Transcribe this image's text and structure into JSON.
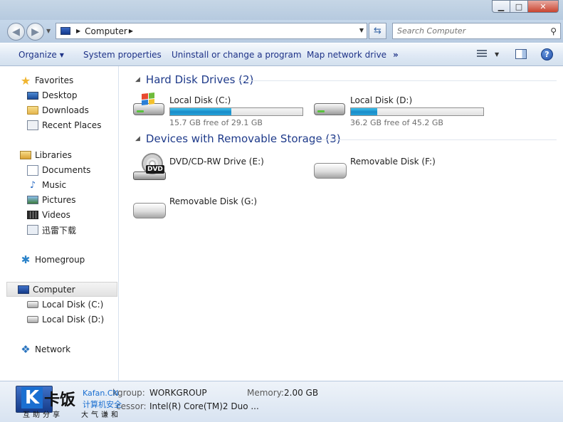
{
  "window": {
    "minimize_glyph": "▁",
    "maximize_glyph": "□",
    "close_glyph": "✕"
  },
  "address": {
    "path": "Computer",
    "search_placeholder": "Search Computer"
  },
  "toolbar": {
    "organize": "Organize",
    "system_properties": "System properties",
    "uninstall": "Uninstall or change a program",
    "map_drive": "Map network drive",
    "more": "»",
    "help": "?"
  },
  "nav": {
    "favorites": "Favorites",
    "desktop": "Desktop",
    "downloads": "Downloads",
    "recent_places": "Recent Places",
    "libraries": "Libraries",
    "documents": "Documents",
    "music": "Music",
    "pictures": "Pictures",
    "videos": "Videos",
    "xunlei": "迅雷下载",
    "homegroup": "Homegroup",
    "computer": "Computer",
    "local_c": "Local Disk (C:)",
    "local_d": "Local Disk (D:)",
    "network": "Network"
  },
  "content": {
    "hdd_header": "Hard Disk Drives (2)",
    "removable_header": "Devices with Removable Storage (3)",
    "hdd": [
      {
        "name": "Local Disk (C:)",
        "free": "15.7 GB free of 29.1 GB",
        "used_fraction": 0.46
      },
      {
        "name": "Local Disk (D:)",
        "free": "36.2 GB free of 45.2 GB",
        "used_fraction": 0.2
      }
    ],
    "removable": [
      {
        "name": "DVD/CD-RW Drive (E:)"
      },
      {
        "name": "Removable Disk (F:)"
      },
      {
        "name": "Removable Disk (G:)"
      }
    ]
  },
  "details": {
    "workgroup_label": "kgroup:",
    "workgroup_value": "WORKGROUP",
    "memory_label": "Memory:",
    "memory_value": "2.00 GB",
    "processor_label": "cessor:",
    "processor_value": "Intel(R) Core(TM)2 Duo ..."
  },
  "watermark": {
    "logo_letter": "K",
    "brand": "卡饭",
    "site": "Kafan.CN",
    "security": "计算机安全",
    "left": "互助分享",
    "right": "大气谦和"
  }
}
